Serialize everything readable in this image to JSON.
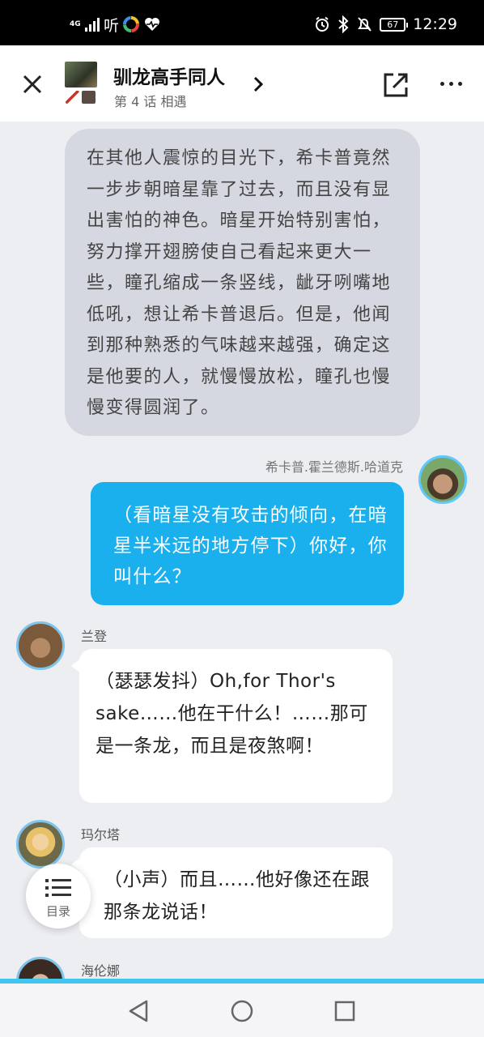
{
  "status_bar": {
    "network": "4G",
    "network_sub": "4G",
    "listen_app": "听",
    "battery": "67",
    "time": "12:29"
  },
  "header": {
    "title": "驯龙高手同人",
    "subtitle": "第 4 话 相遇",
    "icons": [
      "close-icon",
      "chevron-right-icon",
      "share-icon",
      "more-icon"
    ]
  },
  "chat": {
    "narration": "在其他人震惊的目光下，希卡普竟然一步步朝暗星靠了过去，而且没有显出害怕的神色。暗星开始特别害怕，努力撑开翅膀使自己看起来更大一些，瞳孔缩成一条竖线，龇牙咧嘴地低吼，想让希卡普退后。但是，他闻到那种熟悉的气味越来越强，确定这是他要的人，就慢慢放松，瞳孔也慢慢变得圆润了。",
    "me": {
      "name": "希卡普.霍兰德斯.哈道克",
      "text": "（看暗星没有攻击的倾向，在暗星半米远的地方停下）你好，你叫什么？"
    },
    "messages": [
      {
        "name": "兰登",
        "text": "（瑟瑟发抖）Oh,for Thor's sake……他在干什么！……那可是一条龙，而且是夜煞啊！"
      },
      {
        "name": "玛尔塔",
        "text": "（小声）而且……他好像还在跟那条龙说话！"
      },
      {
        "name": "海伦娜",
        "text": ""
      }
    ]
  },
  "toc": {
    "label": "目录"
  },
  "nav": {
    "icons": [
      "back-icon",
      "home-icon",
      "recents-icon"
    ]
  },
  "colors": {
    "accent": "#1ab0ee",
    "nav_bar_line": "#41c7ee",
    "background": "#eceef2"
  }
}
